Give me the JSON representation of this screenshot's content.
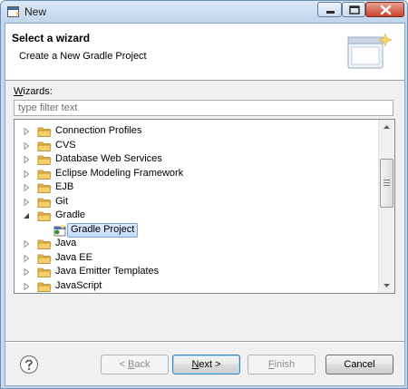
{
  "window": {
    "title": "New"
  },
  "header": {
    "title": "Select a wizard",
    "description": "Create a New Gradle Project"
  },
  "wizards_label": {
    "mnemonic": "W",
    "rest": "izards:"
  },
  "filter": {
    "placeholder": "type filter text",
    "value": ""
  },
  "tree": {
    "items": [
      {
        "label": "Connection Profiles",
        "expanded": false,
        "level": 0
      },
      {
        "label": "CVS",
        "expanded": false,
        "level": 0
      },
      {
        "label": "Database Web Services",
        "expanded": false,
        "level": 0
      },
      {
        "label": "Eclipse Modeling Framework",
        "expanded": false,
        "level": 0
      },
      {
        "label": "EJB",
        "expanded": false,
        "level": 0
      },
      {
        "label": "Git",
        "expanded": false,
        "level": 0
      },
      {
        "label": "Gradle",
        "expanded": true,
        "level": 0
      },
      {
        "label": "Gradle Project",
        "selected": true,
        "level": 1
      },
      {
        "label": "Java",
        "expanded": false,
        "level": 0
      },
      {
        "label": "Java EE",
        "expanded": false,
        "level": 0
      },
      {
        "label": "Java Emitter Templates",
        "expanded": false,
        "level": 0
      },
      {
        "label": "JavaScript",
        "expanded": false,
        "level": 0
      }
    ]
  },
  "buttons": {
    "back": {
      "prefix": "< ",
      "mnemonic": "B",
      "rest": "ack",
      "enabled": false
    },
    "next": {
      "mnemonic": "N",
      "rest": "ext >",
      "enabled": true
    },
    "finish": {
      "mnemonic": "F",
      "rest": "inish",
      "enabled": false
    },
    "cancel": {
      "label": "Cancel",
      "enabled": true
    }
  },
  "icons": {
    "folder": "folder-icon",
    "gradle_project": "gradle-project-icon",
    "help": "help-icon",
    "wizard_banner": "wizard-banner-icon"
  },
  "colors": {
    "folder": "#e8b74a",
    "selection": "#c1dbfc",
    "title_bar": "#c3d8ee"
  }
}
